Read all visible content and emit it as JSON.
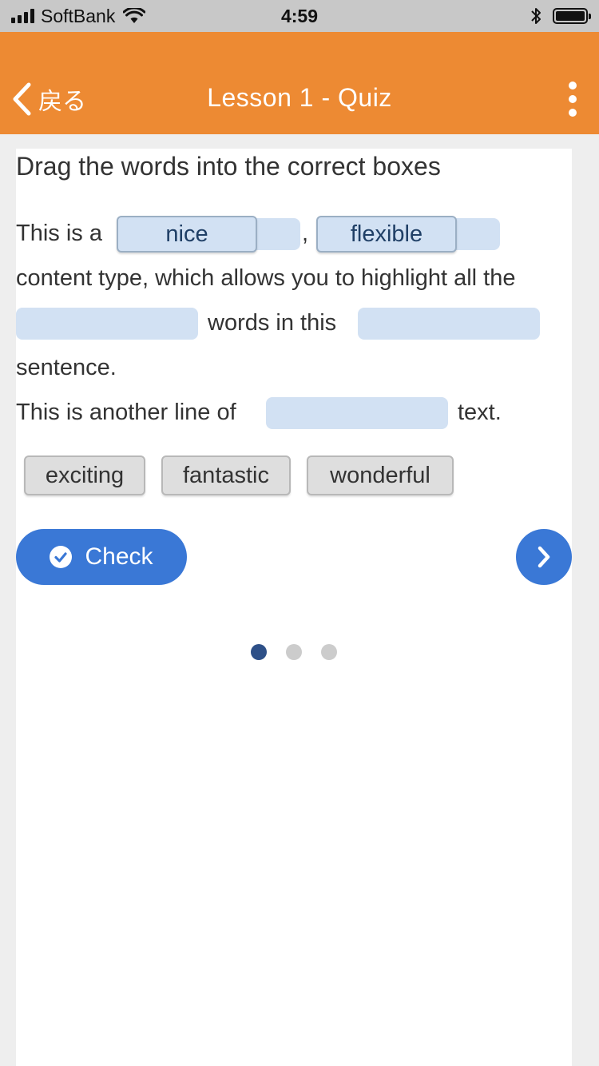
{
  "status_bar": {
    "carrier": "SoftBank",
    "time": "4:59"
  },
  "header": {
    "back_label": "戻る",
    "title": "Lesson 1 - Quiz"
  },
  "quiz": {
    "instruction": "Drag the words into the correct boxes",
    "line1_prefix": "This is a",
    "line1_comma": ",",
    "line2": "content type, which allows you to highlight all the",
    "line3_middle": "words in this",
    "line4": "sentence.",
    "line5_prefix": "This is another line of",
    "line5_suffix": "text.",
    "placed_words": [
      "nice",
      "flexible"
    ],
    "word_bank": [
      "exciting",
      "fantastic",
      "wonderful"
    ]
  },
  "actions": {
    "check_label": "Check"
  },
  "pager": {
    "total": 3,
    "active": 1
  },
  "colors": {
    "header": "#ed8a33",
    "primary": "#3a78d6",
    "drop_zone": "#d2e1f3",
    "pager_active": "#2e5088"
  }
}
